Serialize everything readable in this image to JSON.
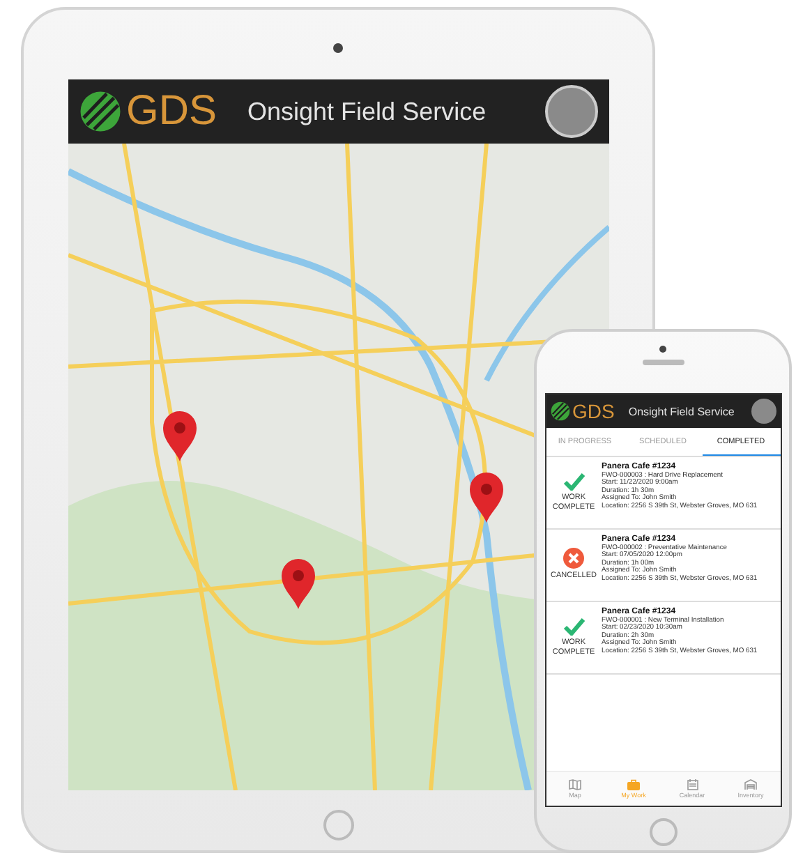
{
  "tablet": {
    "header": {
      "logo_text": "GDS",
      "title": "Onsight Field Service"
    }
  },
  "phone": {
    "header": {
      "logo_text": "GDS",
      "title": "Onsight Field Service"
    },
    "tabs": [
      {
        "label": "IN PROGRESS",
        "selected": false
      },
      {
        "label": "SCHEDULED",
        "selected": false
      },
      {
        "label": "COMPLETED",
        "selected": true
      }
    ],
    "work_orders": [
      {
        "kind": "complete",
        "status": "WORK COMPLETE",
        "title": "Panera Cafe #1234",
        "lines": [
          "FWO-000003 : Hard Drive Replacement",
          "Start: 11/22/2020 9:00am",
          "Duration: 1h 30m",
          "Assigned To: John Smith",
          "Location: 2256 S 39th St, Webster Groves, MO 631"
        ]
      },
      {
        "kind": "cancelled",
        "status": "CANCELLED",
        "title": "Panera Cafe #1234",
        "lines": [
          "FWO-000002 : Preventative Maintenance",
          "Start: 07/05/2020 12:00pm",
          "Duration: 1h 00m",
          "Assigned To: John Smith",
          "Location: 2256 S 39th St, Webster Groves, MO 631"
        ]
      },
      {
        "kind": "complete",
        "status": "WORK COMPLETE",
        "title": "Panera Cafe #1234",
        "lines": [
          "FWO-000001 : New Terminal Installation",
          "Start: 02/23/2020 10:30am",
          "Duration: 2h 30m",
          "Assigned To: John Smith",
          "Location: 2256 S 39th St, Webster Groves, MO 631"
        ]
      }
    ],
    "nav": [
      {
        "kind": "map",
        "label": "Map",
        "selected": false
      },
      {
        "kind": "work",
        "label": "My Work",
        "selected": true
      },
      {
        "kind": "calendar",
        "label": "Calendar",
        "selected": false
      },
      {
        "kind": "inventory",
        "label": "Inventory",
        "selected": false
      }
    ]
  }
}
